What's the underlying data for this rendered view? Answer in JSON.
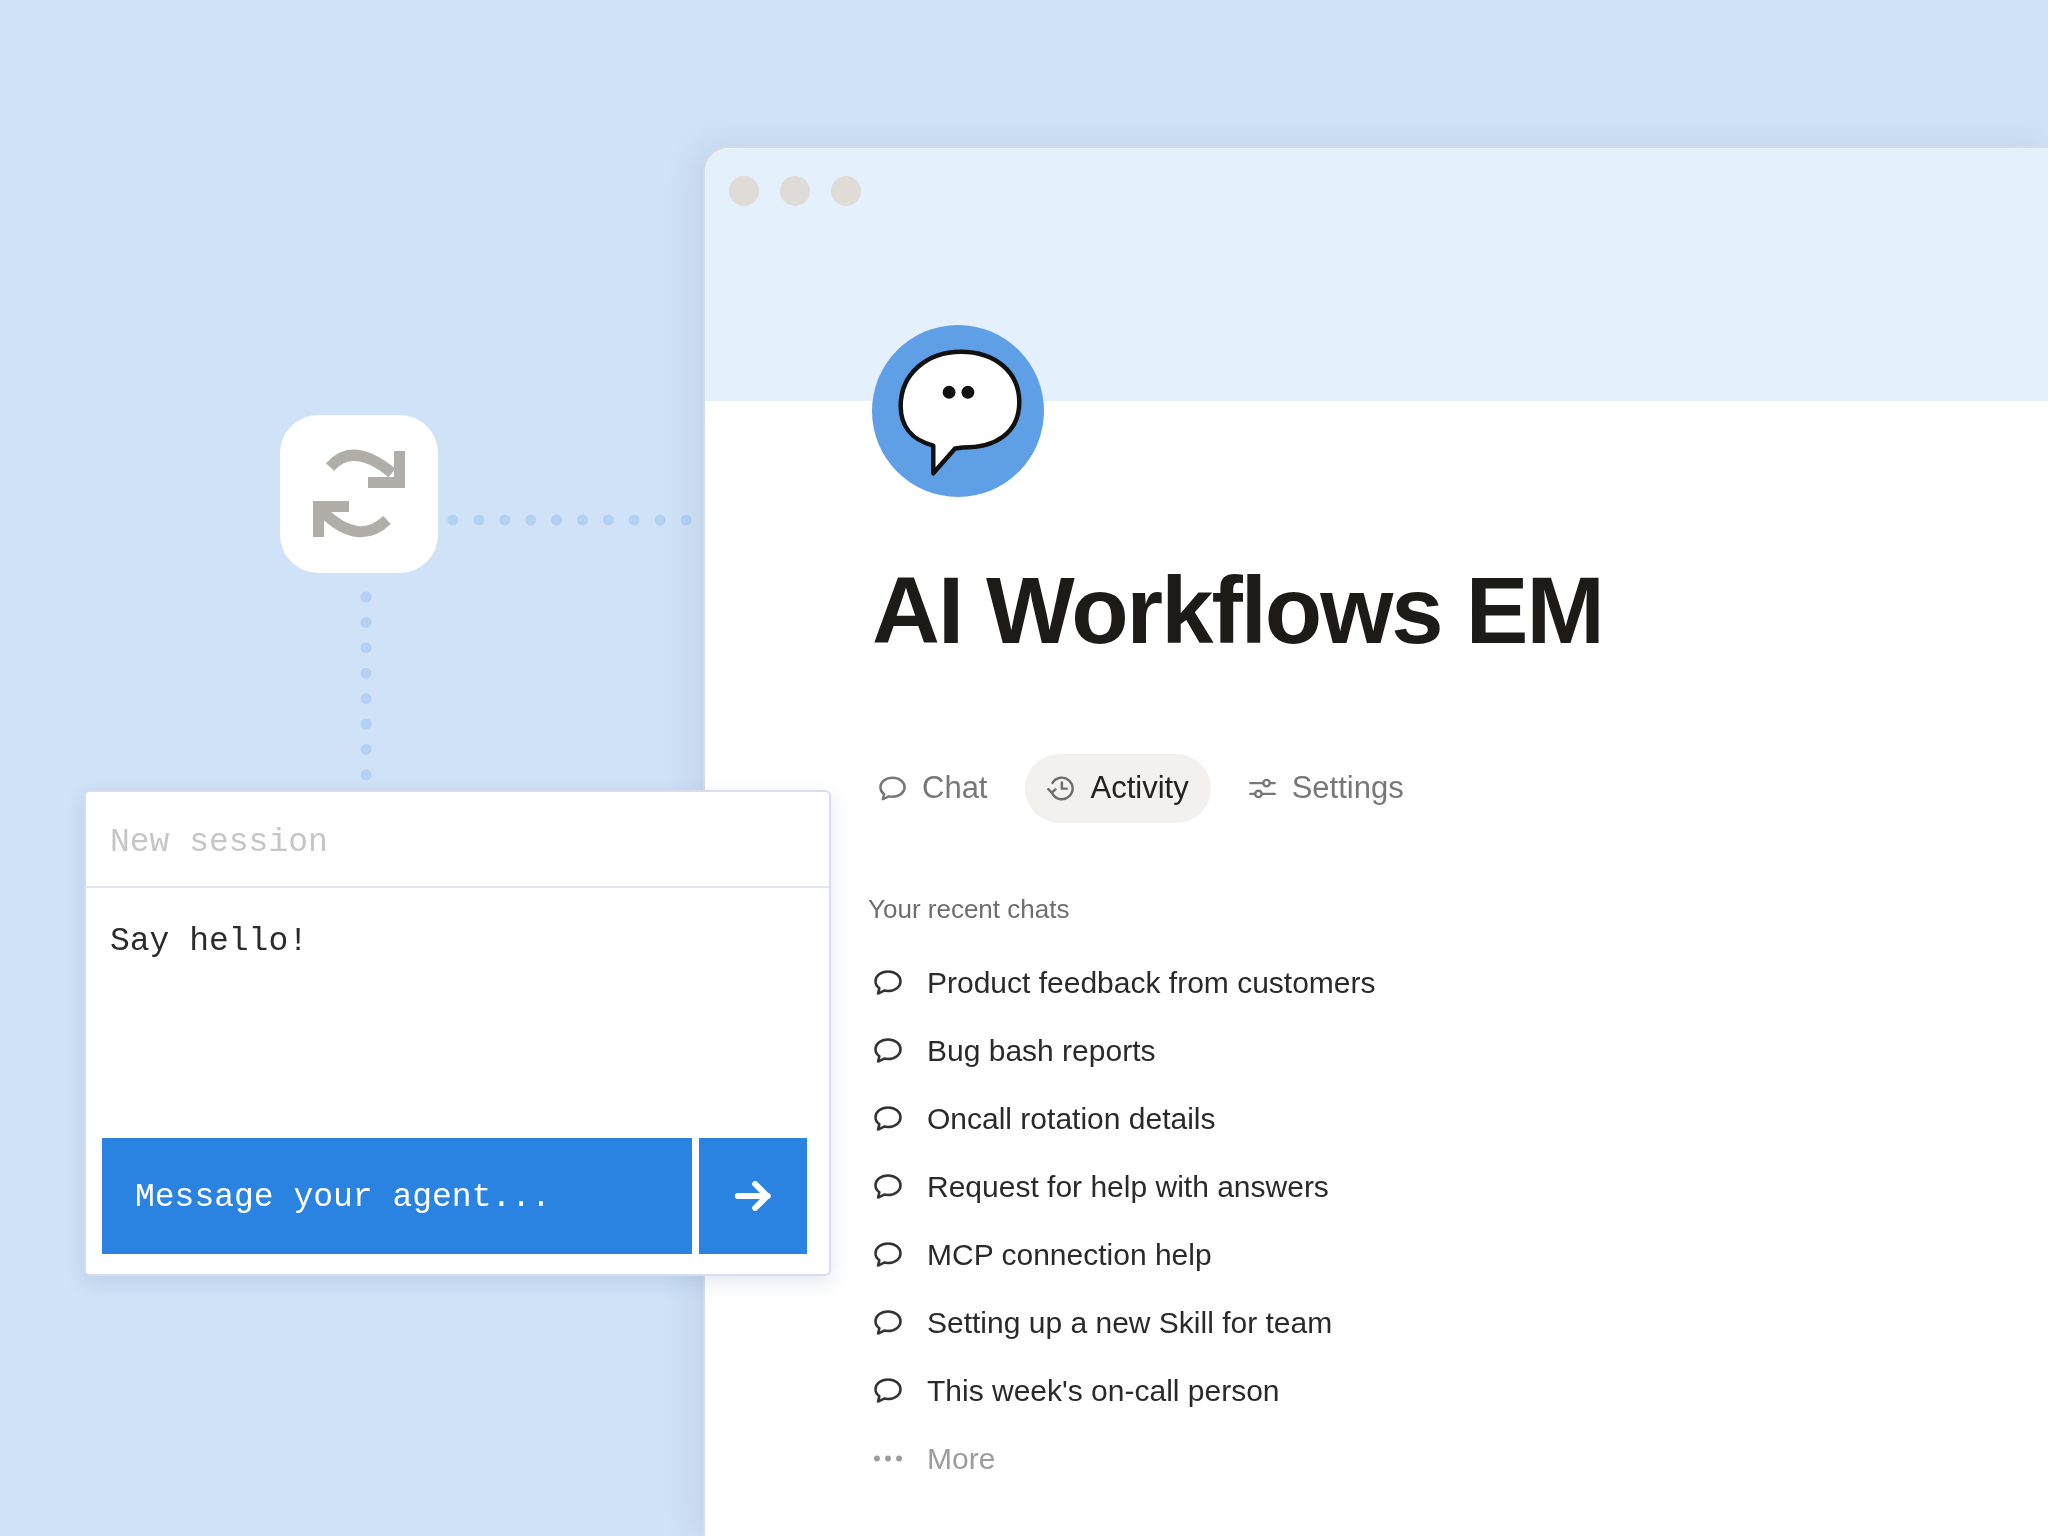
{
  "window": {
    "title": "AI Workflows EM",
    "tabs": [
      {
        "label": "Chat",
        "kind": "chat",
        "selected": false
      },
      {
        "label": "Activity",
        "kind": "activity",
        "selected": true
      },
      {
        "label": "Settings",
        "kind": "settings",
        "selected": false
      }
    ],
    "recent_chats": {
      "heading": "Your recent chats",
      "items": [
        "Product feedback from customers",
        "Bug bash reports",
        "Oncall rotation details",
        "Request for help with answers",
        "MCP connection help",
        "Setting up a new Skill for team",
        "This week's on-call person"
      ],
      "more": {
        "label": "More"
      }
    }
  },
  "session_card": {
    "title_field": {
      "placeholder": "New session"
    },
    "message_area": {
      "value": "Say hello!"
    },
    "composer": {
      "placeholder": "Message your agent..."
    }
  }
}
